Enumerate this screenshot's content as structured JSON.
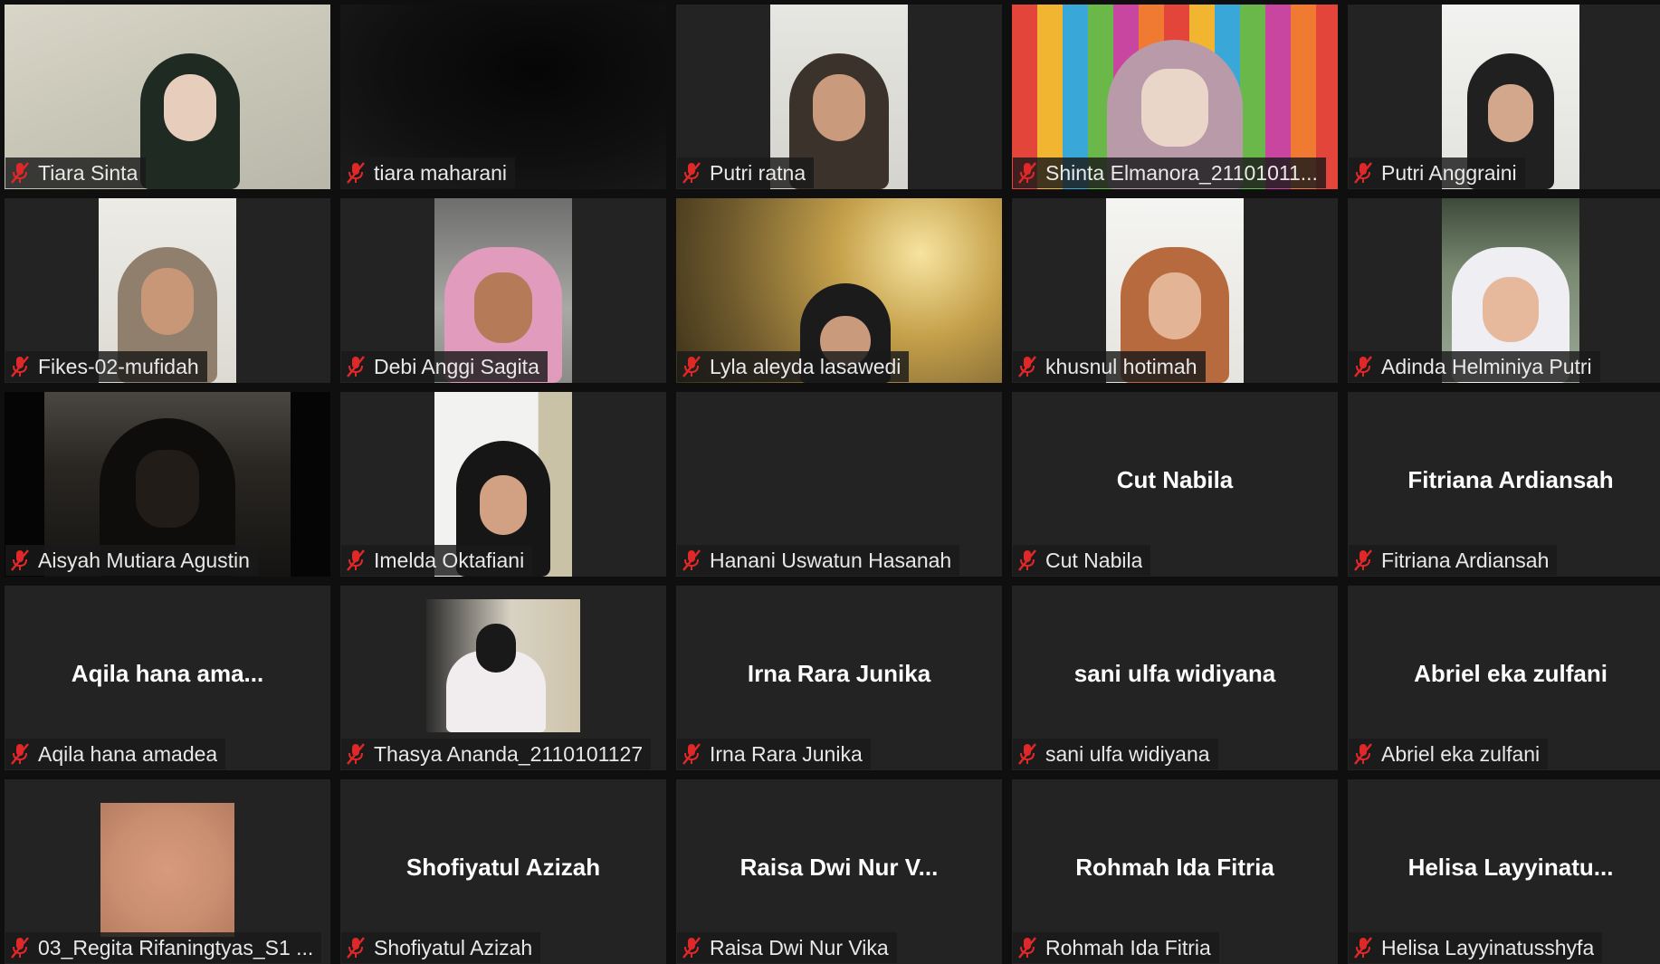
{
  "meeting": {
    "participants": [
      {
        "name": "Tiara Sinta",
        "video": true,
        "muted": true
      },
      {
        "name": "tiara maharani",
        "video": true,
        "muted": true
      },
      {
        "name": "Putri ratna",
        "video": true,
        "muted": true
      },
      {
        "name": "Shinta Elmanora_21101011...",
        "video": true,
        "muted": true
      },
      {
        "name": "Putri Anggraini",
        "video": true,
        "muted": true
      },
      {
        "name": "Fikes-02-mufidah",
        "video": true,
        "muted": true
      },
      {
        "name": "Debi Anggi Sagita",
        "video": true,
        "muted": true
      },
      {
        "name": "Lyla aleyda lasawedi",
        "video": true,
        "muted": true
      },
      {
        "name": "khusnul hotimah",
        "video": true,
        "muted": true
      },
      {
        "name": "Adinda Helminiya Putri",
        "video": true,
        "muted": true
      },
      {
        "name": "Aisyah Mutiara Agustin",
        "video": true,
        "muted": true
      },
      {
        "name": "Imelda Oktafiani",
        "video": true,
        "muted": true
      },
      {
        "name": "Hanani Uswatun Hasanah",
        "video": false,
        "muted": true,
        "display_name": ""
      },
      {
        "name": "Cut Nabila",
        "video": false,
        "muted": true,
        "display_name": "Cut Nabila"
      },
      {
        "name": "Fitriana Ardiansah",
        "video": false,
        "muted": true,
        "display_name": "Fitriana Ardiansah"
      },
      {
        "name": "Aqila hana amadea",
        "video": false,
        "muted": true,
        "display_name": "Aqila  hana  ama..."
      },
      {
        "name": "Thasya Ananda_2110101127",
        "video": true,
        "muted": true
      },
      {
        "name": "Irna Rara Junika",
        "video": false,
        "muted": true,
        "display_name": "Irna Rara Junika"
      },
      {
        "name": "sani ulfa widiyana",
        "video": false,
        "muted": true,
        "display_name": "sani ulfa widiyana"
      },
      {
        "name": "Abriel eka zulfani",
        "video": false,
        "muted": true,
        "display_name": "Abriel eka zulfani"
      },
      {
        "name": "03_Regita Rifaningtyas_S1 ...",
        "video": true,
        "muted": true
      },
      {
        "name": "Shofiyatul Azizah",
        "video": false,
        "muted": true,
        "display_name": "Shofiyatul Azizah"
      },
      {
        "name": "Raisa Dwi Nur Vika",
        "video": false,
        "muted": true,
        "display_name": "Raisa Dwi Nur V..."
      },
      {
        "name": "Rohmah Ida Fitria",
        "video": false,
        "muted": true,
        "display_name": "Rohmah Ida Fitria"
      },
      {
        "name": "Helisa Layyinatusshyfa",
        "video": false,
        "muted": true,
        "display_name": "Helisa  Layyinatu..."
      }
    ]
  },
  "icons": {
    "muted_mic": "muted-microphone-icon"
  },
  "colors": {
    "tile_bg": "#232323",
    "muted_icon": "#e02828",
    "name_text": "#e8e8e8"
  }
}
